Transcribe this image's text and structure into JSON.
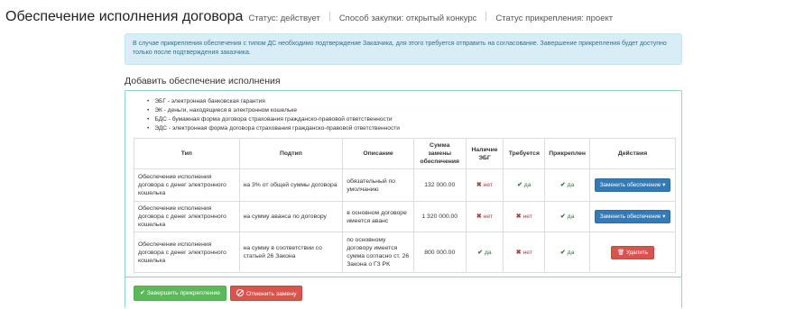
{
  "header": {
    "title": "Обеспечение исполнения договора",
    "status": "Статус: действует",
    "purchase_method": "Способ закупки: открытый конкурс",
    "attachment_status": "Статус прикрепления: проект"
  },
  "alert": {
    "text": "В случае прикрепления обеспечения с типом ДС необходимо подтверждение Заказчика, для этого требуется отправить на согласование. Завершение прикрепления будет доступно только после подтверждения заказчика."
  },
  "section": {
    "title": "Добавить обеспечение исполнения"
  },
  "legend": [
    "ЭБГ - электронная банковская гарантия",
    "ЭК - деньги, находящиеся в электронном кошельке",
    "БДС - бумажная форма договора страхования гражданско-правовой ответственности",
    "ЭДС - электронная форма договора страхования гражданско-правовой ответственности"
  ],
  "table": {
    "headers": {
      "type": "Тип",
      "subtype": "Подтип",
      "description": "Описание",
      "amount": "Сумма замены обеспечения",
      "ebg": "Наличие ЭБГ",
      "required": "Требуется",
      "attached": "Прикреплен",
      "actions": "Действия"
    },
    "rows": [
      {
        "type": "Обеспечение исполнения договора с денег электронного кошелька",
        "subtype": "на 3% от общей суммы договора",
        "description": "обязательный по умолчанию",
        "amount": "132 000.00",
        "ebg": {
          "mark": "✖",
          "label": "нет"
        },
        "required": {
          "mark": "✔",
          "label": "да"
        },
        "attached": {
          "mark": "✔",
          "label": "да"
        },
        "action": "Заменить обеспечение ▾"
      },
      {
        "type": "Обеспечение исполнения договора с денег электронного кошелька",
        "subtype": "на сумму аванса по договору",
        "description": "в основном договоре имеется аванс",
        "amount": "1 320 000.00",
        "ebg": {
          "mark": "✖",
          "label": "нет"
        },
        "required": {
          "mark": "✖",
          "label": "нет"
        },
        "attached": {
          "mark": "✔",
          "label": "да"
        },
        "action": "Заменить обеспечение ▾"
      },
      {
        "type": "Обеспечение исполнения договора с денег электронного кошелька",
        "subtype": "на сумму в соответствии со статьей 26 Закона",
        "description": "по основному договору имеется сумма согласно ст. 26 Закона о ГЗ РК",
        "amount": "800 000.00",
        "ebg": {
          "mark": "✔",
          "label": "да"
        },
        "required": {
          "mark": "✖",
          "label": "нет"
        },
        "attached": {
          "mark": "✔",
          "label": "да"
        },
        "action": "Удалить"
      }
    ]
  },
  "buttons": {
    "complete": "Завершить прикрепление",
    "cancel": "Отменить замену"
  },
  "colors": {
    "alert_bg": "#d9edf7",
    "panel_border": "#8fd4c6",
    "primary": "#337ab7",
    "success": "#5cb85c",
    "danger": "#d9534f",
    "yes": "#3c763d",
    "no": "#a94442"
  }
}
